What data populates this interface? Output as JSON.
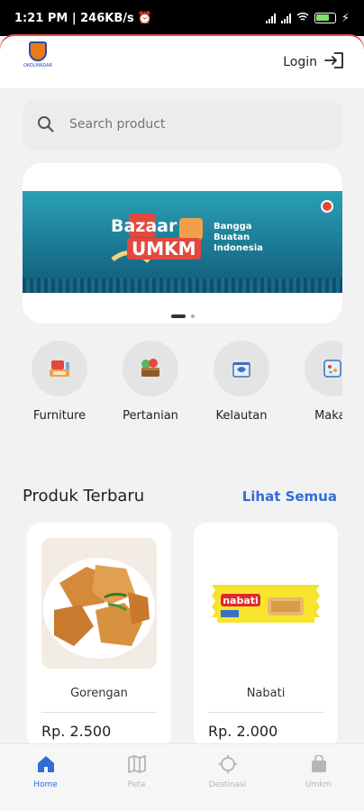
{
  "status_bar": {
    "time_speed": "1:21 PM | 246KB/s",
    "battery": "82"
  },
  "header": {
    "logo_text": "OKOLMADAR",
    "login_label": "Login"
  },
  "search": {
    "placeholder": "Search product"
  },
  "banner": {
    "title_line1": "Bazaar",
    "title_line2": "UMKM",
    "tagline": "Bangga Buatan Indonesia"
  },
  "categories": [
    {
      "label": "Furniture",
      "icon": "furniture-icon"
    },
    {
      "label": "Pertanian",
      "icon": "agriculture-icon"
    },
    {
      "label": "Kelautan",
      "icon": "marine-icon"
    },
    {
      "label": "Makar",
      "icon": "food-icon"
    }
  ],
  "section": {
    "title": "Produk Terbaru",
    "see_all": "Lihat Semua"
  },
  "products": [
    {
      "name": "Gorengan",
      "price": "Rp. 2.500"
    },
    {
      "name": "Nabati",
      "price": "Rp. 2.000",
      "brand": "nabati"
    }
  ],
  "nav": [
    {
      "label": "Home",
      "icon": "home-icon",
      "active": true
    },
    {
      "label": "Peta",
      "icon": "map-icon"
    },
    {
      "label": "Destinasi",
      "icon": "destination-icon"
    },
    {
      "label": "Umkm",
      "icon": "shopping-bag-icon"
    }
  ],
  "colors": {
    "accent": "#2f6ed6",
    "header_edge": "#e0524a"
  }
}
